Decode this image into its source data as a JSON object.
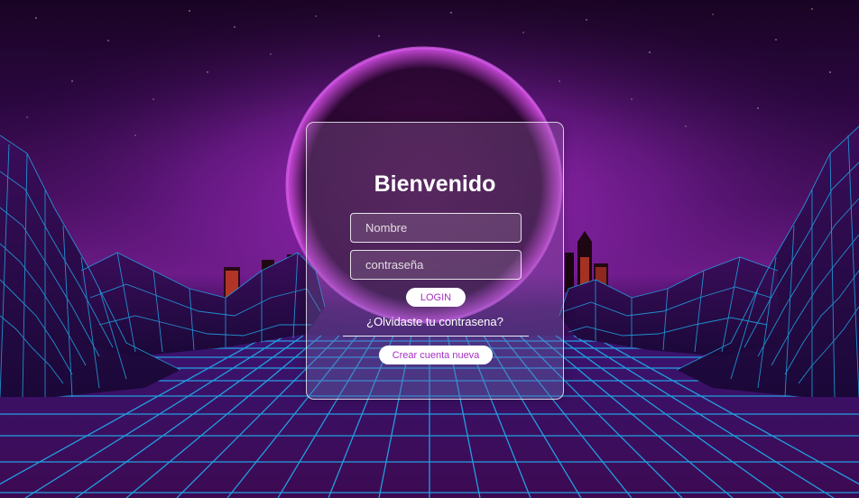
{
  "login": {
    "title": "Bienvenido",
    "username_placeholder": "Nombre",
    "password_placeholder": "contraseña",
    "login_button": "LOGIN",
    "forgot_link": "¿Olvidaste tu contrasena?",
    "create_account_button": "Crear cuenta nueva"
  },
  "theme": {
    "accent": "#a52fc3",
    "grid": "#22a6e8",
    "sky": "#7a1f98"
  }
}
